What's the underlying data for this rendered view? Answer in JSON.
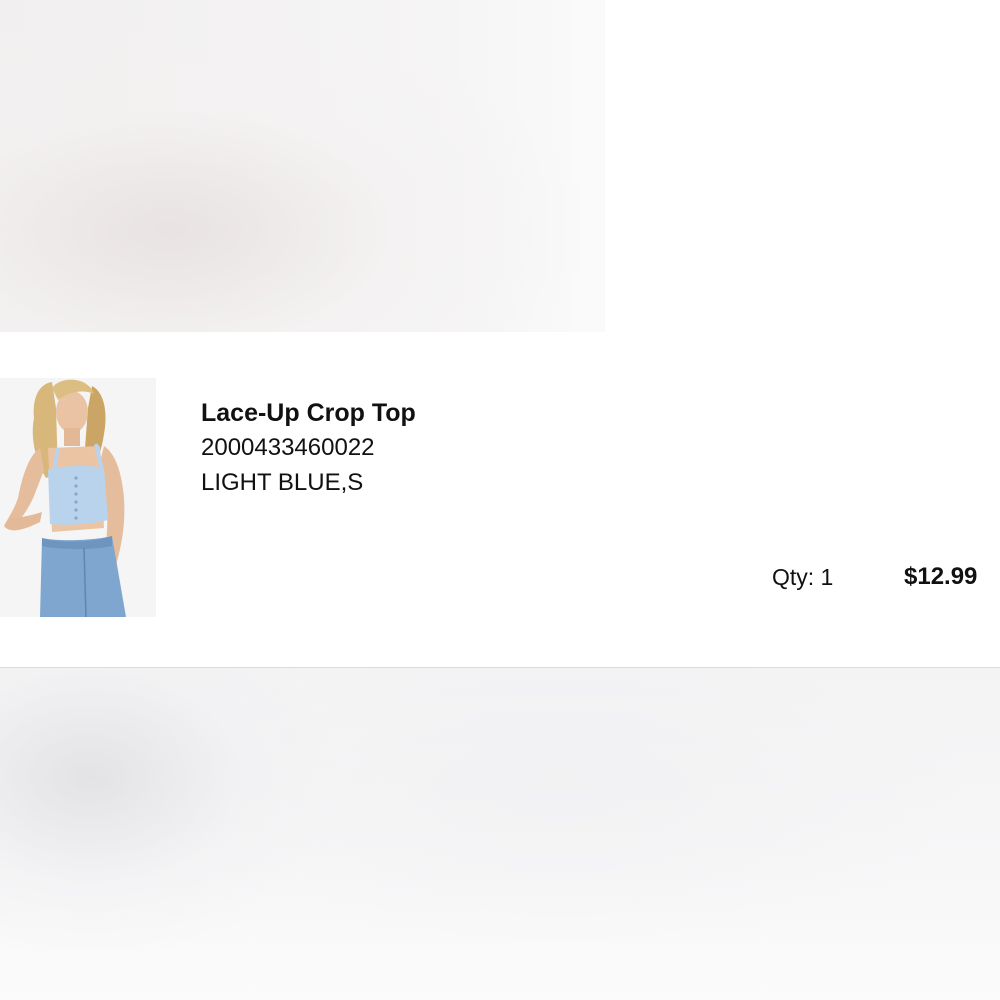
{
  "item": {
    "name": "Lace-Up Crop Top",
    "sku": "2000433460022",
    "variant": "LIGHT BLUE,S",
    "qty_label": "Qty: 1",
    "price": "$12.99",
    "image_icon": "product-photo"
  },
  "colors": {
    "text": "#111111",
    "top_color": "#b9d3ec",
    "denim": "#7fa6cf"
  }
}
